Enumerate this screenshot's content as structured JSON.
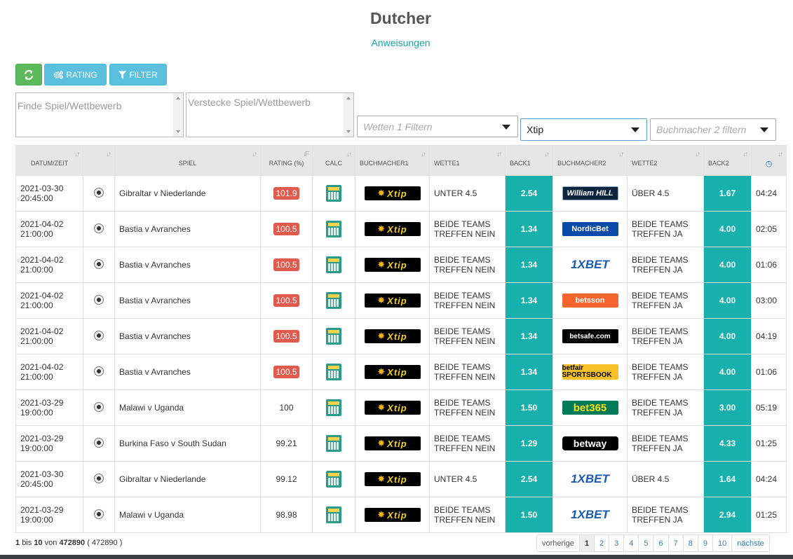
{
  "page": {
    "title": "Dutcher",
    "instructions_link": "Anweisungen"
  },
  "toolbar": {
    "refresh_icon": "refresh-icon",
    "rating_label": "RATING",
    "filter_label": "FILTER"
  },
  "filters": {
    "search_placeholder": "Finde Spiel/Wettbewerb",
    "hide_placeholder": "Verstecke Spiel/Wettbewerb",
    "wette1_placeholder": "Wetten 1 Filtern",
    "buchmacher1_value": "Xtip",
    "buchmacher2_placeholder": "Buchmacher 2 filtern"
  },
  "table": {
    "headers": {
      "datum": "DATUM/ZEIT",
      "spiel": "SPIEL",
      "rating": "RATING (%)",
      "calc": "CALC",
      "buchmacher1": "BUCHMACHER1",
      "wette1": "WETTE1",
      "back1": "BACK1",
      "buchmacher2": "BUCHMACHER2",
      "wette2": "WETTE2",
      "back2": "BACK2"
    },
    "rows": [
      {
        "date": "2021-03-30",
        "time": "20:45:00",
        "spiel": "Gibraltar v Niederlande",
        "rating": "101.9",
        "rating_badge": true,
        "bm1": "Xtip",
        "wette1_a": "UNTER 4.5",
        "wette1_b": "",
        "back1": "2.54",
        "bm2": "William HILL",
        "bm2_style": "wh",
        "wette2_a": "ÜBER 4.5",
        "wette2_b": "",
        "back2": "1.67",
        "age": "04:24"
      },
      {
        "date": "2021-04-02",
        "time": "21:00:00",
        "spiel": "Bastia v Avranches",
        "rating": "100.5",
        "rating_badge": true,
        "bm1": "Xtip",
        "wette1_a": "BEIDE TEAMS",
        "wette1_b": "TREFFEN NEIN",
        "back1": "1.34",
        "bm2": "NordicBet",
        "bm2_style": "nb",
        "wette2_a": "BEIDE TEAMS",
        "wette2_b": "TREFFEN JA",
        "back2": "4.00",
        "age": "02:05"
      },
      {
        "date": "2021-04-02",
        "time": "21:00:00",
        "spiel": "Bastia v Avranches",
        "rating": "100.5",
        "rating_badge": true,
        "bm1": "Xtip",
        "wette1_a": "BEIDE TEAMS",
        "wette1_b": "TREFFEN NEIN",
        "back1": "1.34",
        "bm2": "1XBET",
        "bm2_style": "1x",
        "wette2_a": "BEIDE TEAMS",
        "wette2_b": "TREFFEN JA",
        "back2": "4.00",
        "age": "01:06"
      },
      {
        "date": "2021-04-02",
        "time": "21:00:00",
        "spiel": "Bastia v Avranches",
        "rating": "100.5",
        "rating_badge": true,
        "bm1": "Xtip",
        "wette1_a": "BEIDE TEAMS",
        "wette1_b": "TREFFEN NEIN",
        "back1": "1.34",
        "bm2": "betsson",
        "bm2_style": "bs",
        "wette2_a": "BEIDE TEAMS",
        "wette2_b": "TREFFEN JA",
        "back2": "4.00",
        "age": "03:00"
      },
      {
        "date": "2021-04-02",
        "time": "21:00:00",
        "spiel": "Bastia v Avranches",
        "rating": "100.5",
        "rating_badge": true,
        "bm1": "Xtip",
        "wette1_a": "BEIDE TEAMS",
        "wette1_b": "TREFFEN NEIN",
        "back1": "1.34",
        "bm2": "betsafe.com",
        "bm2_style": "bf",
        "wette2_a": "BEIDE TEAMS",
        "wette2_b": "TREFFEN JA",
        "back2": "4.00",
        "age": "04:19"
      },
      {
        "date": "2021-04-02",
        "time": "21:00:00",
        "spiel": "Bastia v Avranches",
        "rating": "100.5",
        "rating_badge": true,
        "bm1": "Xtip",
        "wette1_a": "BEIDE TEAMS",
        "wette1_b": "TREFFEN NEIN",
        "back1": "1.34",
        "bm2": "betfair SPORTSBOOK",
        "bm2_style": "bfs",
        "wette2_a": "BEIDE TEAMS",
        "wette2_b": "TREFFEN JA",
        "back2": "4.00",
        "age": "01:06"
      },
      {
        "date": "2021-03-29",
        "time": "19:00:00",
        "spiel": "Malawi v Uganda",
        "rating": "100",
        "rating_badge": false,
        "bm1": "Xtip",
        "wette1_a": "BEIDE TEAMS",
        "wette1_b": "TREFFEN NEIN",
        "back1": "1.50",
        "bm2": "bet365",
        "bm2_style": "365",
        "wette2_a": "BEIDE TEAMS",
        "wette2_b": "TREFFEN JA",
        "back2": "3.00",
        "age": "05:19"
      },
      {
        "date": "2021-03-29",
        "time": "19:00:00",
        "spiel": "Burkina Faso v South Sudan",
        "rating": "99.21",
        "rating_badge": false,
        "bm1": "Xtip",
        "wette1_a": "BEIDE TEAMS",
        "wette1_b": "TREFFEN NEIN",
        "back1": "1.29",
        "bm2": "betway",
        "bm2_style": "bw",
        "wette2_a": "BEIDE TEAMS",
        "wette2_b": "TREFFEN JA",
        "back2": "4.33",
        "age": "01:25"
      },
      {
        "date": "2021-03-30",
        "time": "20:45:00",
        "spiel": "Gibraltar v Niederlande",
        "rating": "99.12",
        "rating_badge": false,
        "bm1": "Xtip",
        "wette1_a": "UNTER 4.5",
        "wette1_b": "",
        "back1": "2.54",
        "bm2": "1XBET",
        "bm2_style": "1x",
        "wette2_a": "ÜBER 4.5",
        "wette2_b": "",
        "back2": "1.64",
        "age": "04:24"
      },
      {
        "date": "2021-03-29",
        "time": "19:00:00",
        "spiel": "Malawi v Uganda",
        "rating": "98.98",
        "rating_badge": false,
        "bm1": "Xtip",
        "wette1_a": "BEIDE TEAMS",
        "wette1_b": "TREFFEN NEIN",
        "back1": "1.50",
        "bm2": "1XBET",
        "bm2_style": "1x",
        "wette2_a": "BEIDE TEAMS",
        "wette2_b": "TREFFEN JA",
        "back2": "2.94",
        "age": "01:25"
      }
    ]
  },
  "footer": {
    "info_from": "1",
    "info_bis": "bis",
    "info_to": "10",
    "info_von": "von",
    "info_total": "472890",
    "info_total_paren": "( 472890 )",
    "pager": {
      "prev": "vorherige",
      "pages": [
        "1",
        "2",
        "3",
        "4",
        "5",
        "6",
        "7",
        "8",
        "9",
        "10"
      ],
      "next": "nächste",
      "active": "1"
    }
  },
  "colors": {
    "accent": "#17b0ad",
    "rating_badge": "#e05a4e",
    "refresh_button": "#5cb85c",
    "info_button": "#5bc0de"
  }
}
